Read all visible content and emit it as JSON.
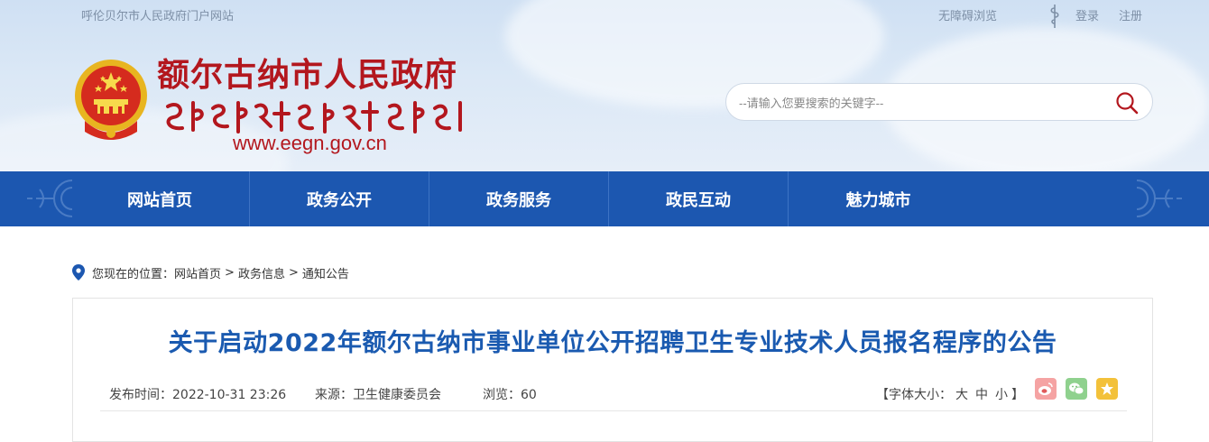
{
  "topbar": {
    "portal_text": "呼伦贝尔市人民政府门户网站",
    "accessibility": "无障碍浏览",
    "login": "登录",
    "register": "注册"
  },
  "brand": {
    "name": "额尔古纳市人民政府",
    "url": "www.eegn.gov.cn",
    "color": "#b3171e"
  },
  "search": {
    "placeholder": "--请输入您要搜索的关键字--"
  },
  "nav": {
    "items": [
      "网站首页",
      "政务公开",
      "政务服务",
      "政民互动",
      "魅力城市"
    ],
    "background": "#1c57b0"
  },
  "breadcrumb": {
    "prefix": "您现在的位置：",
    "items": [
      "网站首页",
      "政务信息",
      "通知公告"
    ],
    "separator": ">"
  },
  "article": {
    "title": "关于启动2022年额尔古纳市事业单位公开招聘卫生专业技术人员报名程序的公告",
    "published_label": "发布时间：",
    "published_value": "2022-10-31 23:26",
    "source_label": "来源：",
    "source_value": "卫生健康委员会",
    "views_label": "浏览：",
    "views_value": "60",
    "font_size_label": "【字体大小：",
    "font_large": "大",
    "font_medium": "中",
    "font_small": "小",
    "font_size_close": "】",
    "title_color": "#1a5ab0"
  },
  "share": {
    "icons": [
      "weibo-icon",
      "wechat-icon",
      "favorite-icon"
    ],
    "colors": [
      "#f08e8e",
      "#7cc97b",
      "#f3c13a"
    ]
  }
}
